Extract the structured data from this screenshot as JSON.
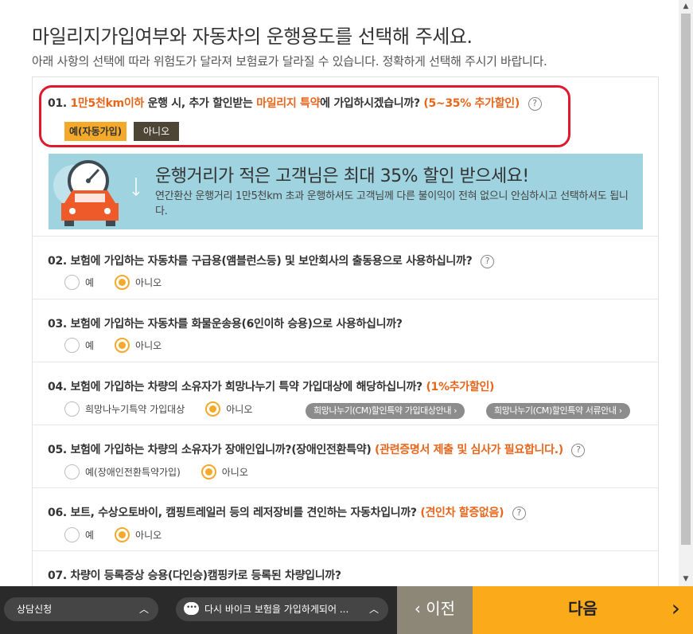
{
  "header": {
    "title": "마일리지가입여부와 자동차의 운행용도를 선택해 주세요.",
    "subtitle": "아래 사항의 선택에 따라 위험도가 달라져 보험료가 달라질 수 있습니다. 정확하게 선택해 주시기 바랍니다."
  },
  "q1": {
    "num": "01.",
    "hl1": "1만5천km이하",
    "t1": " 운행 시, 추가 할인받는 ",
    "hl2": "마일리지 특약",
    "t2": "에 가입하시겠습니까? ",
    "hl3": "(5~35% 추가할인)",
    "yes_label": "예(자동가입)",
    "no_label": "아니오",
    "selected": "yes"
  },
  "banner": {
    "title": "운행거리가 적은 고객님은 최대 35% 할인 받으세요!",
    "desc": "연간환산 운행거리 1만5천km 초과 운행하셔도 고객님께 다른 불이익이 전혀 없으니 안심하시고 선택하셔도 됩니다."
  },
  "q2": {
    "text": "02. 보험에 가입하는 자동차를 구급용(앰블런스등) 및 보안회사의 출동용으로 사용하십니까?",
    "opt_yes": "예",
    "opt_no": "아니오",
    "selected": "no"
  },
  "q3": {
    "text": "03. 보험에 가입하는 자동차를 화물운송용(6인이하 승용)으로 사용하십니까?",
    "opt_yes": "예",
    "opt_no": "아니오",
    "selected": "no"
  },
  "q4": {
    "text": "04. 보험에 가입하는 차량의 소유자가 희망나누기 특약 가입대상에 해당하십니까? ",
    "hl": "(1%추가할인)",
    "opt_yes": "희망나누기특약 가입대상",
    "opt_no": "아니오",
    "selected": "no",
    "link1": "희망나누기(CM)할인특약 가입대상안내 ›",
    "link2": "희망나누기(CM)할인특약 서류안내 ›"
  },
  "q5": {
    "text": "05. 보험에 가입하는 차량의 소유자가 장애인입니까?(장애인전환특약) ",
    "hl": "(관련증명서 제출 및 심사가 필요합니다.)",
    "opt_yes": "예(장애인전환특약가입)",
    "opt_no": "아니오",
    "selected": "no"
  },
  "q6": {
    "text": "06. 보트, 수상오토바이, 캠핑트레일러 등의 레저장비를 견인하는 자동차입니까? ",
    "hl": "(견인차 할증없음)",
    "opt_yes": "예",
    "opt_no": "아니오",
    "selected": "no"
  },
  "q7": {
    "text": "07. 차량이 등록증상 승용(다인승)캠핑카로 등록된 차량입니까?"
  },
  "footer": {
    "consult_label": "상담신청",
    "chat_label": "다시 바이크 보험을 가입하게되어 ...",
    "prev_label": "이전",
    "next_label": "다음"
  },
  "colors": {
    "accent": "#f4a92a",
    "highlight_text": "#e8661b",
    "alert_ring": "#e0192d",
    "next_button": "#fbab19"
  },
  "icons": [
    "help-icon",
    "speedometer-car-icon",
    "chat-bubble-icon",
    "chevron-up-icon",
    "chevron-left-icon",
    "chevron-right-icon"
  ]
}
